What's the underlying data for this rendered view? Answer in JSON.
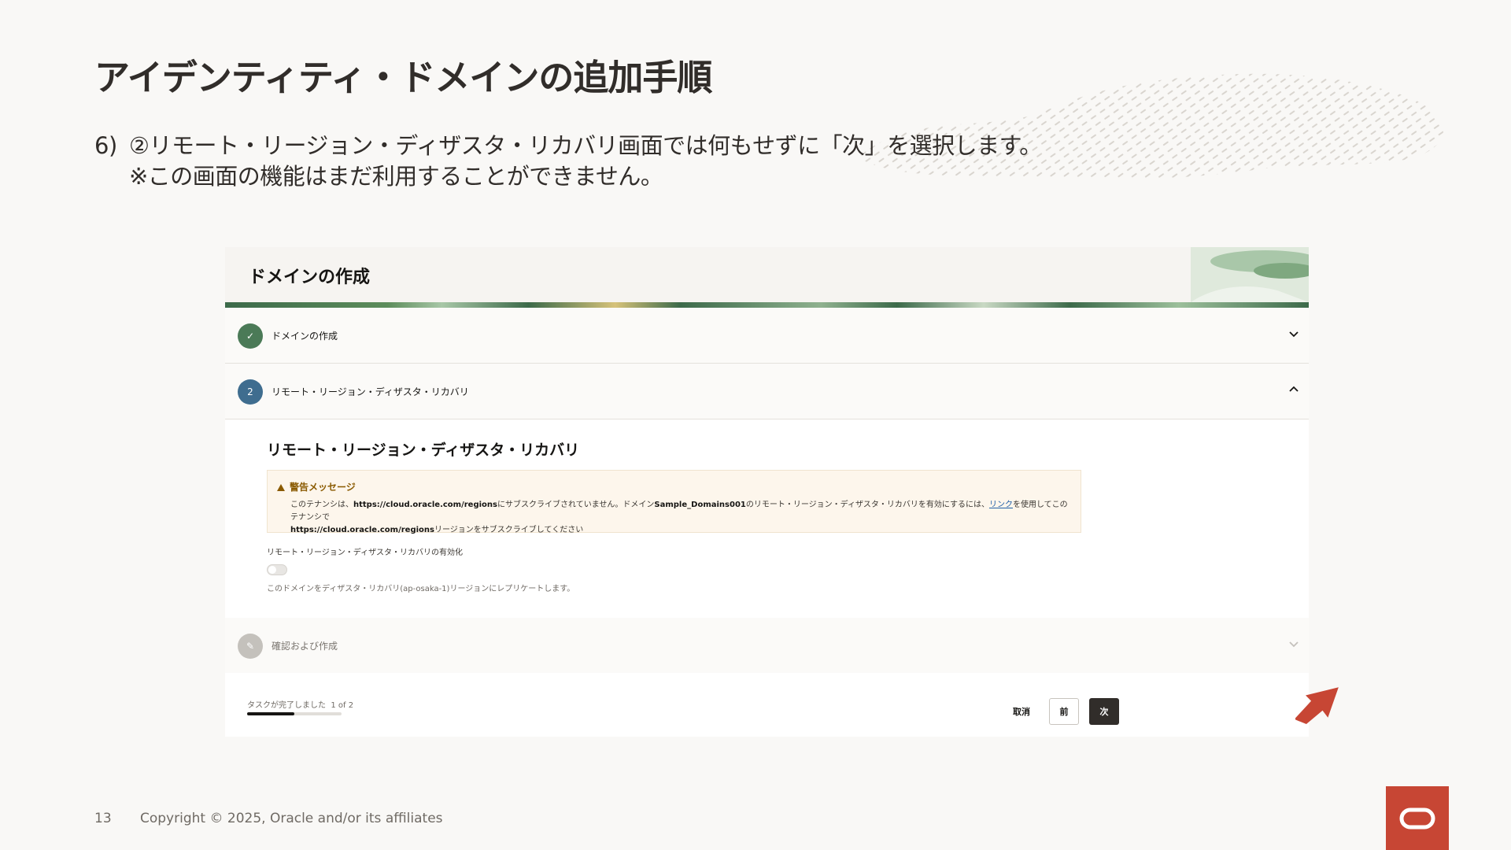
{
  "slide": {
    "title": "アイデンティティ・ドメインの追加手順",
    "instruction_number": "6)",
    "instruction_line1": "②リモート・リージョン・ディザスタ・リカバリ画面では何もせずに「次」を選択します。",
    "instruction_line2": "※この画面の機能はまだ利用することができません。",
    "page_number": "13",
    "copyright": "Copyright © 2025, Oracle and/or its affiliates",
    "colors": {
      "accent": "#c74634",
      "text": "#312d2a",
      "background": "#f9f8f6"
    }
  },
  "screenshot": {
    "header_title": "ドメインの作成",
    "steps": [
      {
        "label": "ドメインの作成",
        "marker": "✓",
        "state": "done"
      },
      {
        "label": "リモート・リージョン・ディザスタ・リカバリ",
        "marker": "2",
        "state": "active"
      },
      {
        "label": "確認および作成",
        "marker": "✎",
        "state": "todo"
      }
    ],
    "panel": {
      "heading": "リモート・リージョン・ディザスタ・リカバリ",
      "warning_title": "警告メッセージ",
      "warning_text_1": "このテナンシは、",
      "warning_url_1": "https://cloud.oracle.com/regions",
      "warning_text_2": "にサブスクライブされていません。ドメイン",
      "warning_domain": "Sample_Domains001",
      "warning_text_3": "のリモート・リージョン・ディザスタ・リカバリを有効にするには、",
      "warning_link": "リンク",
      "warning_text_4": "を使用してこのテナンシで",
      "warning_url_2": "https://cloud.oracle.com/regions",
      "warning_text_5": "リージョンをサブスクライブしてください",
      "toggle_label": "リモート・リージョン・ディザスタ・リカバリの有効化",
      "toggle_on": false,
      "toggle_help": "このドメインをディザスタ・リカバリ(ap-osaka-1)リージョンにレプリケートします。"
    },
    "footer": {
      "progress_label": "タスクが完了しました",
      "progress_count": "1 of 2",
      "progress_fraction": 0.5,
      "cancel_label": "取消",
      "prev_label": "前",
      "next_label": "次"
    }
  }
}
